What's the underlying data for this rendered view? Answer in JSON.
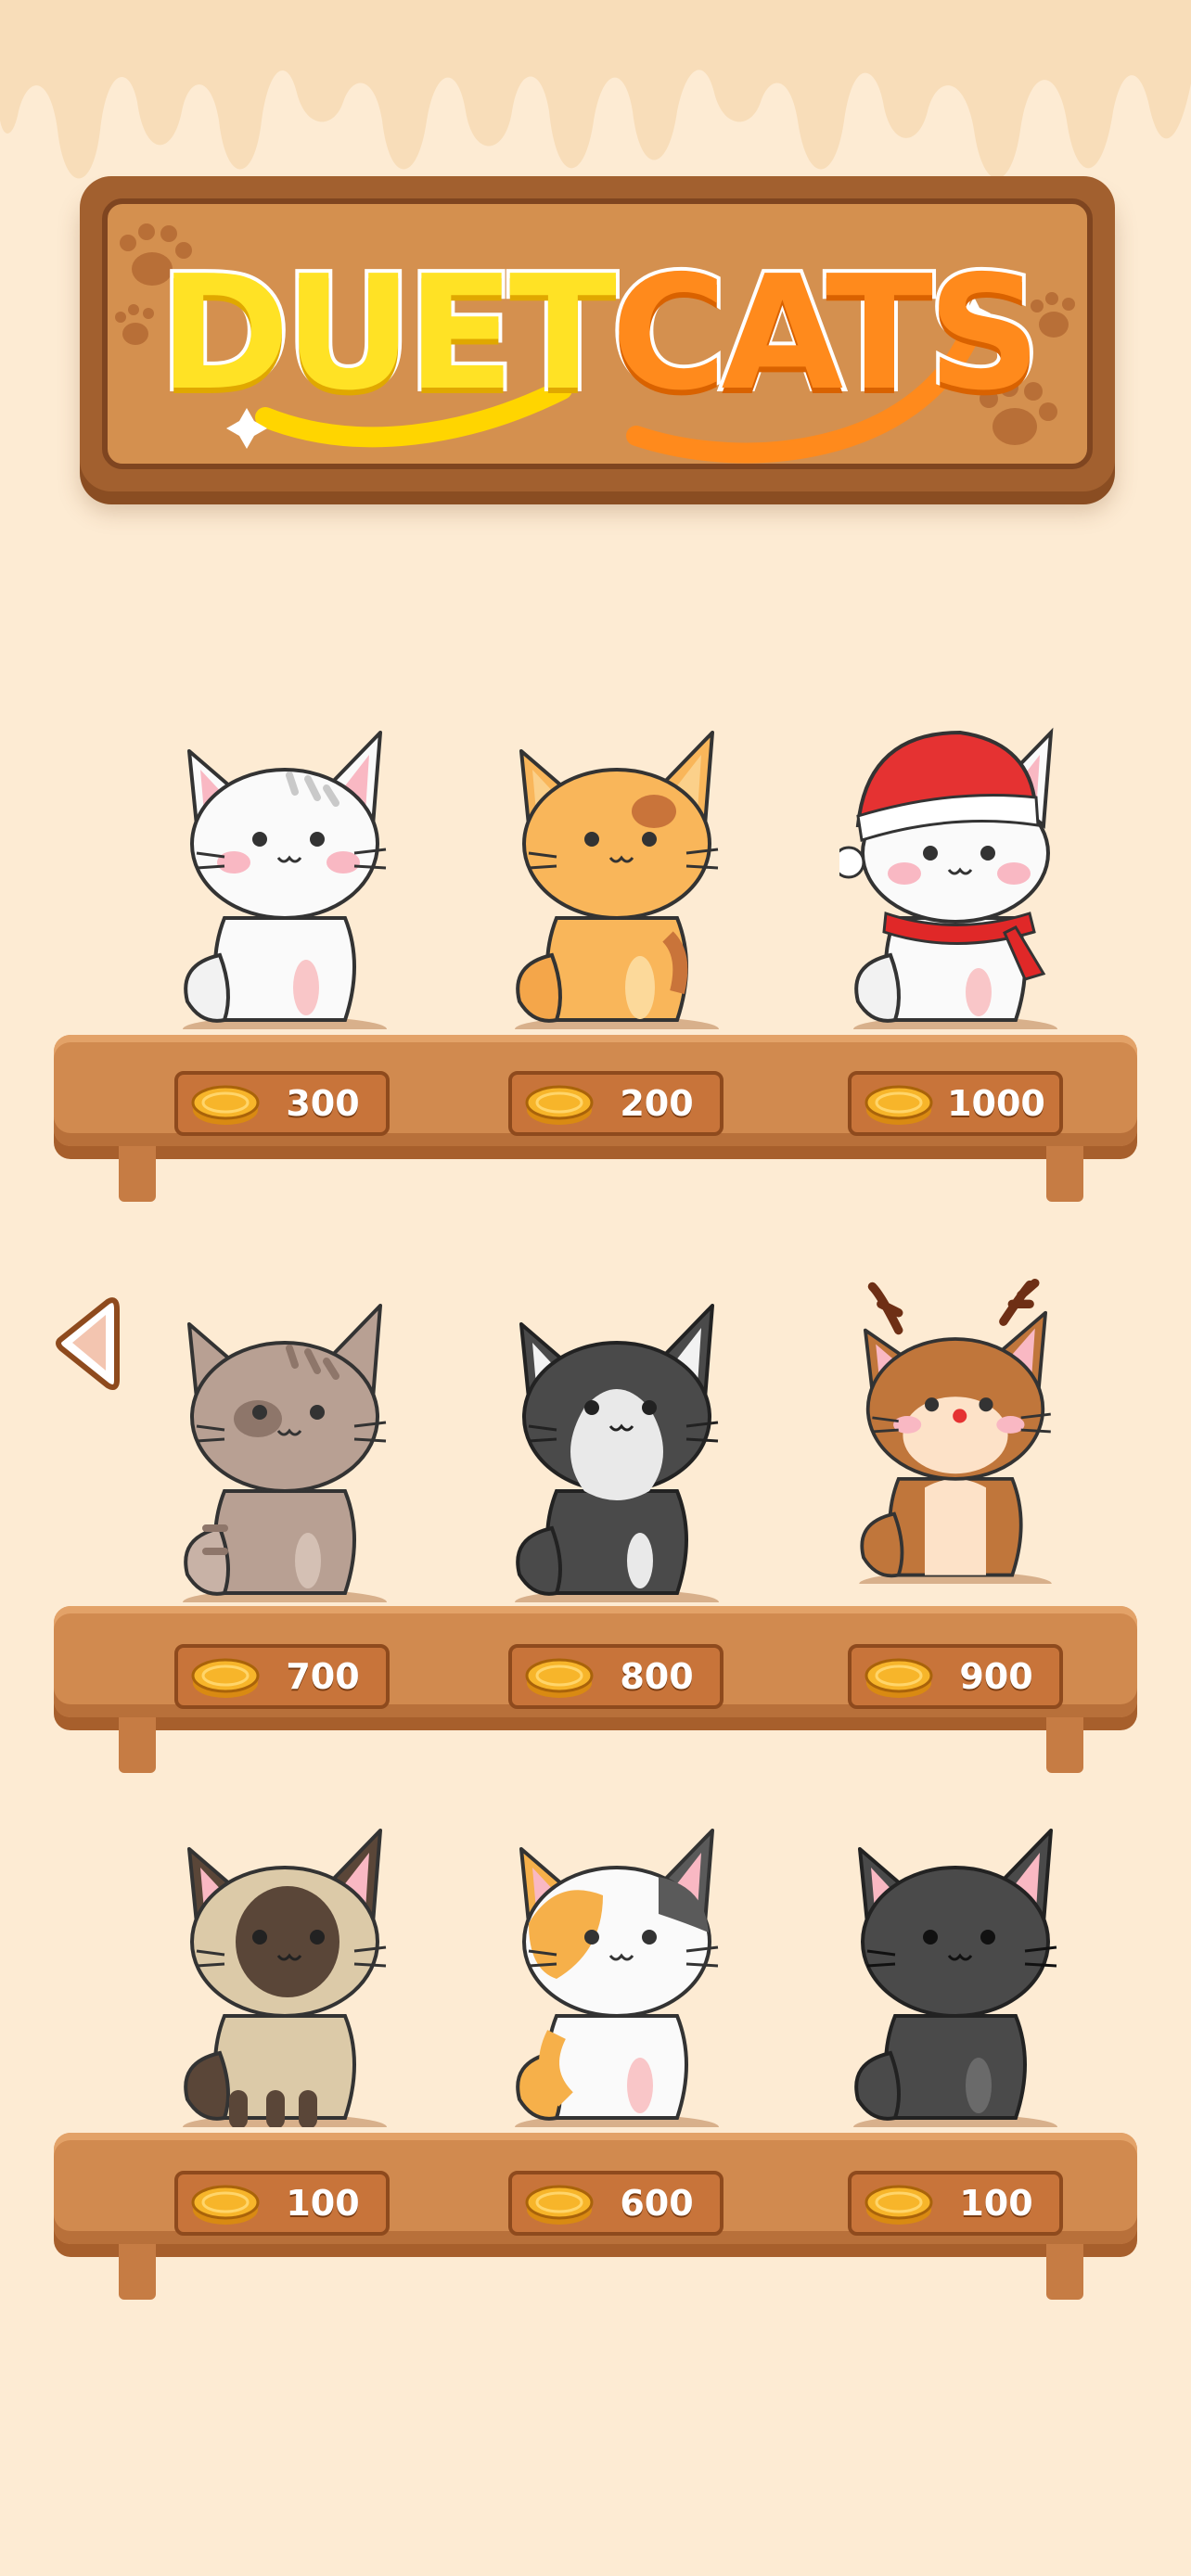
{
  "game": {
    "title_part1": "DUET",
    "title_part2": "CATS"
  },
  "colors": {
    "background": "#fdebd3",
    "board": "#d4904f",
    "shelf": "#d18a4f",
    "price_tag": "#c8743a",
    "coin": "#f7b52a"
  },
  "shop": {
    "rows": [
      {
        "cats": [
          {
            "name": "white-tabby-cat",
            "price": "300"
          },
          {
            "name": "orange-cat",
            "price": "200"
          },
          {
            "name": "santa-hat-cat",
            "price": "1000"
          }
        ]
      },
      {
        "cats": [
          {
            "name": "brown-tabby-cat",
            "price": "700"
          },
          {
            "name": "tuxedo-cat",
            "price": "800"
          },
          {
            "name": "reindeer-cat",
            "price": "900"
          }
        ]
      },
      {
        "cats": [
          {
            "name": "siamese-cat",
            "price": "100"
          },
          {
            "name": "calico-cat",
            "price": "600"
          },
          {
            "name": "black-cat",
            "price": "100"
          }
        ]
      }
    ]
  },
  "icons": {
    "coin": "coin-icon",
    "back": "left-arrow-icon"
  }
}
